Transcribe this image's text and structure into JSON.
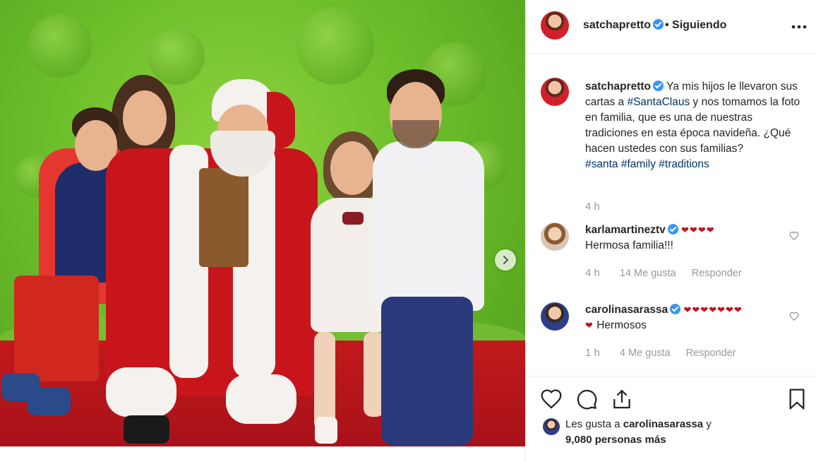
{
  "post": {
    "author": "satchapretto",
    "follow_status": "• Siguiendo",
    "caption_text": "Ya mis hijos le llevaron sus cartas a ",
    "caption_tag1": "#SantaClaus",
    "caption_text2": " y nos tomamos la foto en familia, que es una de nuestras tradiciones en esta época navideña. ¿Qué hacen ustedes con sus familias?",
    "hashtags": [
      "#santa",
      "#family",
      "#traditions"
    ],
    "caption_time": "4 h"
  },
  "comments": [
    {
      "user": "karlamartineztv",
      "hearts": "❤❤❤❤",
      "text": "Hermosa familia!!!",
      "time": "4 h",
      "likes": "14 Me gusta",
      "reply": "Responder"
    },
    {
      "user": "carolinasarassa",
      "hearts": "❤❤❤❤❤❤❤",
      "hearts2": "❤",
      "text": "Hermosos",
      "time": "1 h",
      "likes": "4 Me gusta",
      "reply": "Responder"
    }
  ],
  "likes_summary": {
    "prefix": "Les gusta a",
    "user": "carolinasarassa",
    "joiner": "y",
    "others": "9,080 personas más"
  },
  "icons": {
    "more": "more-options-icon",
    "like": "heart-icon",
    "comment": "comment-icon",
    "share": "share-icon",
    "save": "bookmark-icon",
    "next": "chevron-right-icon"
  },
  "colors": {
    "verified": "#3897f0",
    "hashtag": "#003569",
    "secondary_text": "#999999",
    "heart": "#c1121f"
  }
}
